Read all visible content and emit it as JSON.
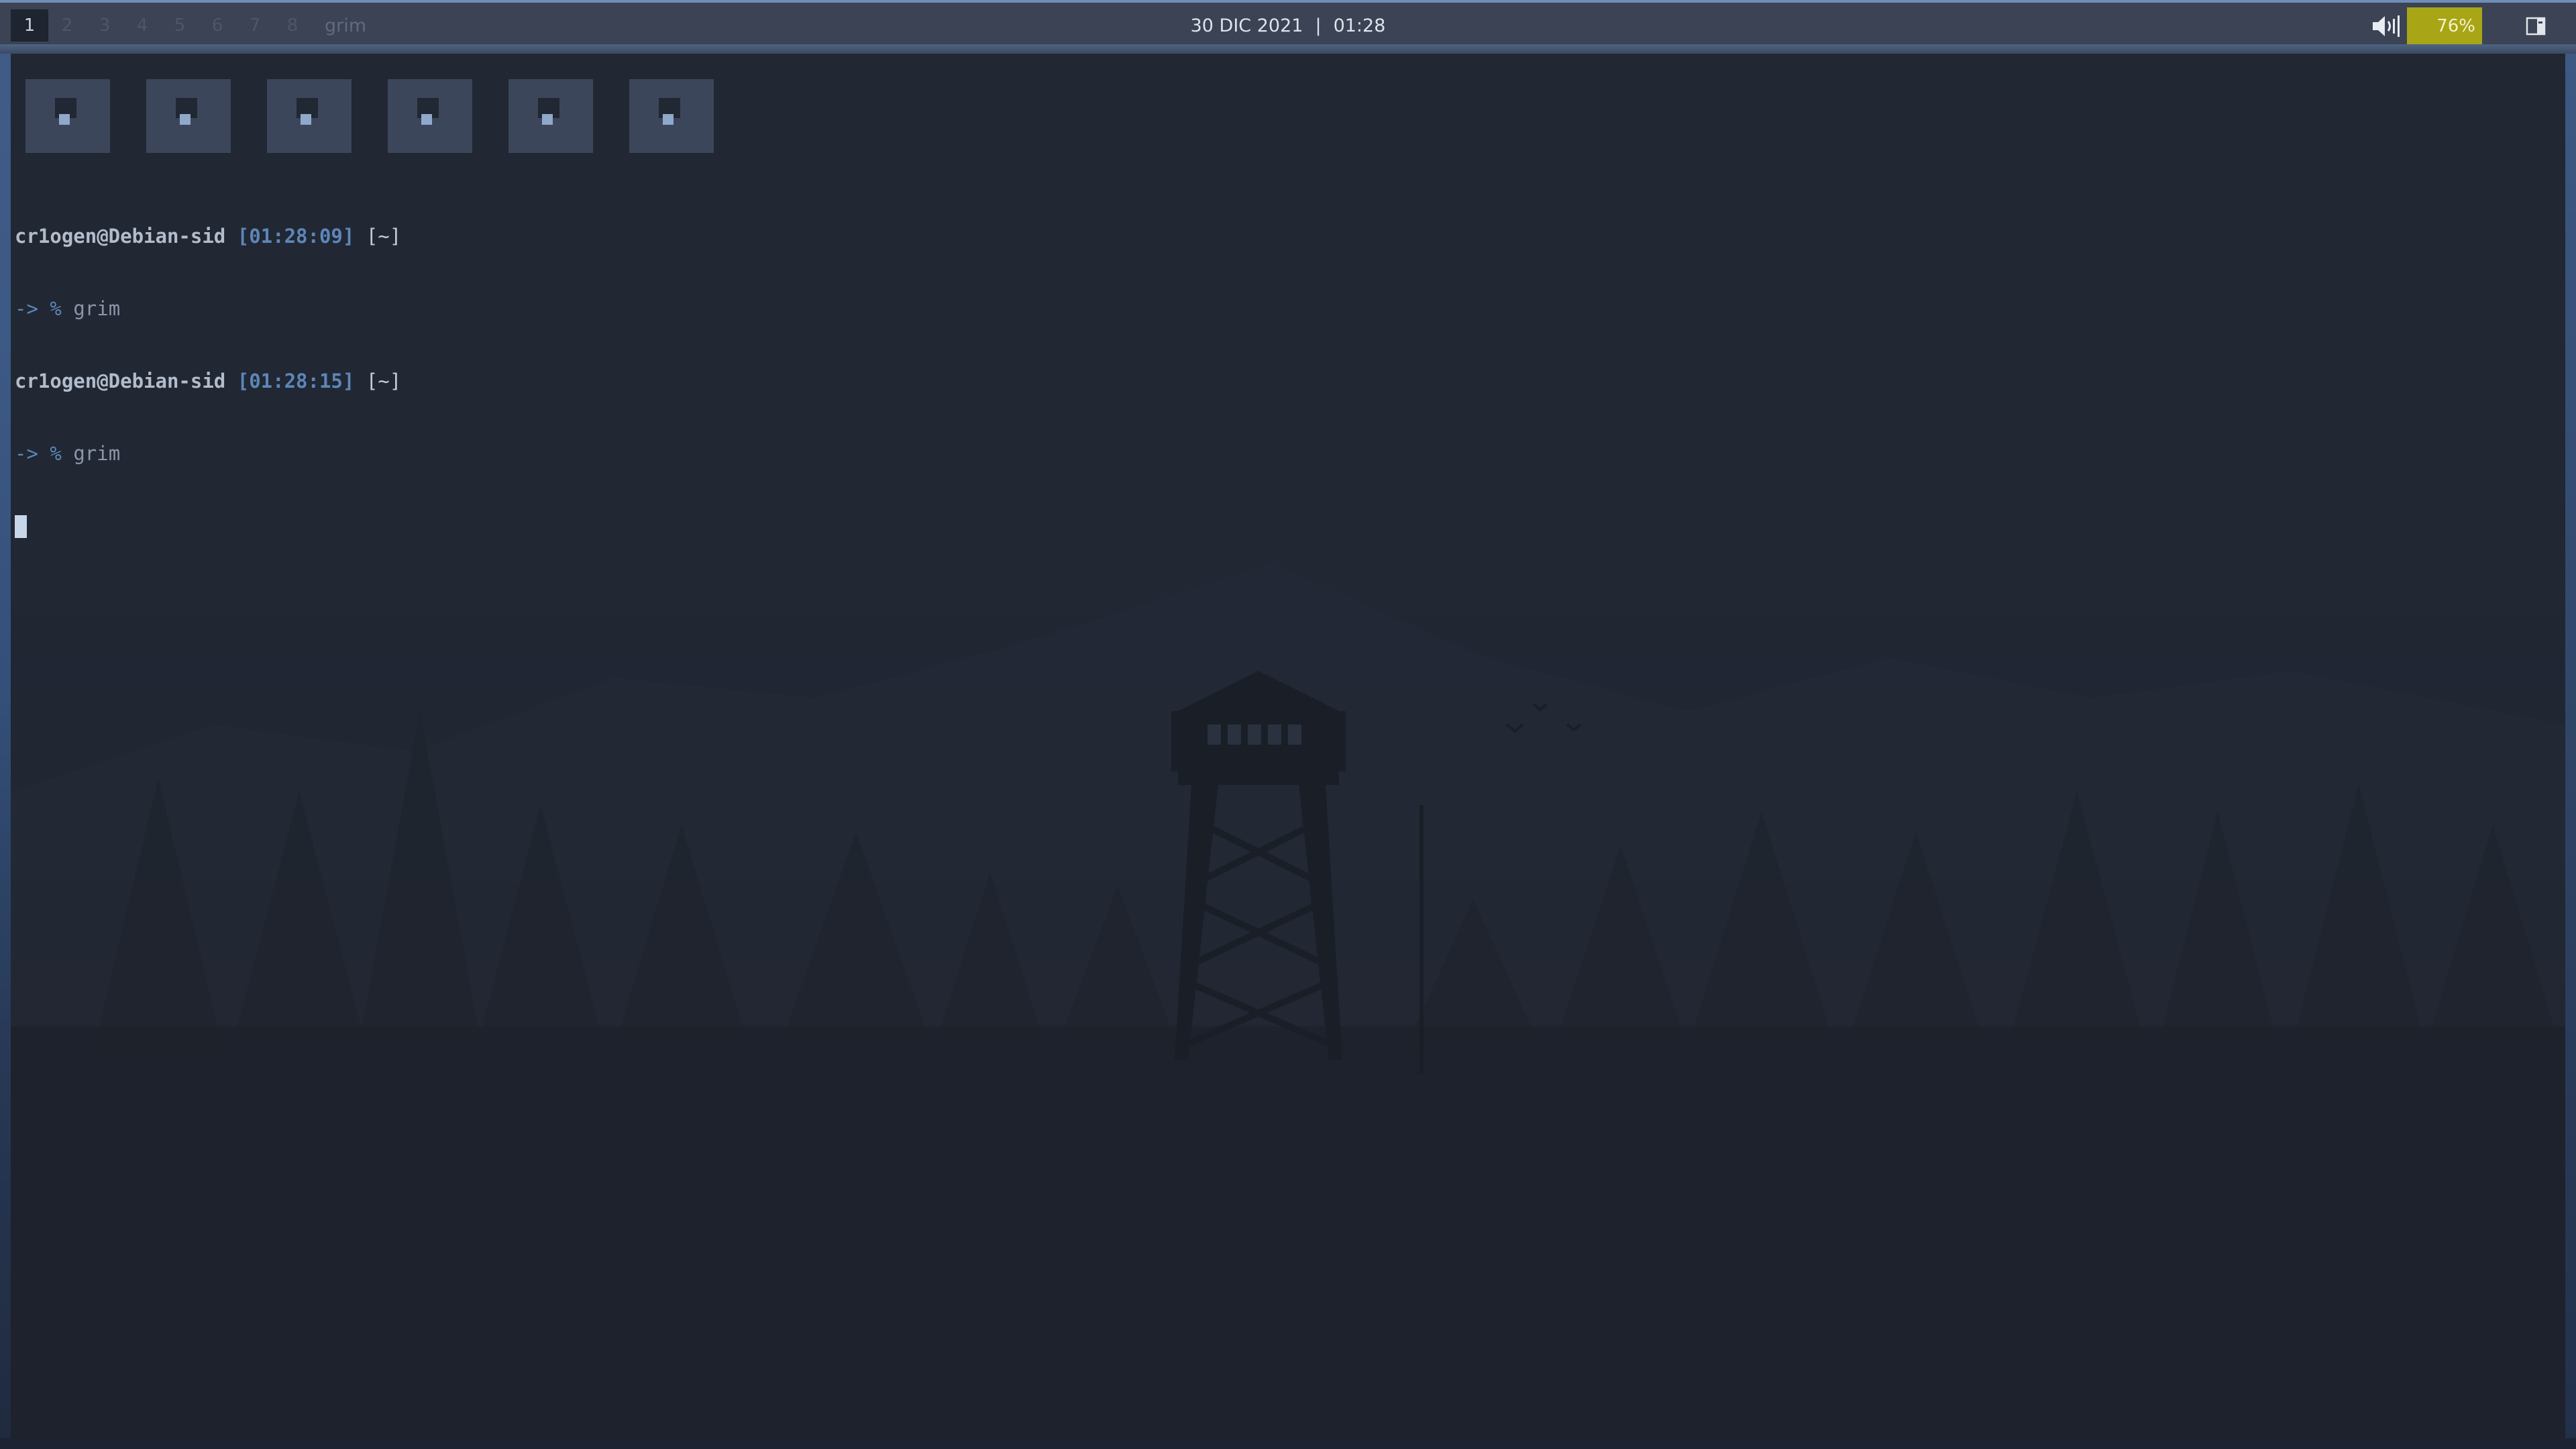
{
  "colors": {
    "bar_bg": "#3b4354",
    "bar_accent": "#6f8db7",
    "battery_bg": "#a8a516",
    "terminal_bg": "#1f232d",
    "prompt_user": "#b2bccb",
    "prompt_time": "#5d86b8"
  },
  "bar": {
    "workspaces": [
      {
        "label": "1",
        "active": true
      },
      {
        "label": "2",
        "active": false
      },
      {
        "label": "3",
        "active": false
      },
      {
        "label": "4",
        "active": false
      },
      {
        "label": "5",
        "active": false
      },
      {
        "label": "6",
        "active": false
      },
      {
        "label": "7",
        "active": false
      },
      {
        "label": "8",
        "active": false
      }
    ],
    "window_title": "grim",
    "date": "30 DIC 2021",
    "separator": "|",
    "time": "01:28",
    "volume_icon": "speaker-volume-icon",
    "battery": "76%",
    "layout_icon": "layout-toggle-icon"
  },
  "terminal": {
    "logo_icon": "debian-logo-icon",
    "lines": [
      {
        "user": "cr1ogen@Debian-sid",
        "time": "[01:28:09]",
        "dir": "[~]"
      },
      {
        "prompt": "-> %",
        "command": "grim"
      },
      {
        "user": "cr1ogen@Debian-sid",
        "time": "[01:28:15]",
        "dir": "[~]"
      },
      {
        "prompt": "-> %",
        "command": "grim"
      }
    ]
  },
  "wallpaper": {
    "subject": "fire-lookout-tower-forest"
  }
}
